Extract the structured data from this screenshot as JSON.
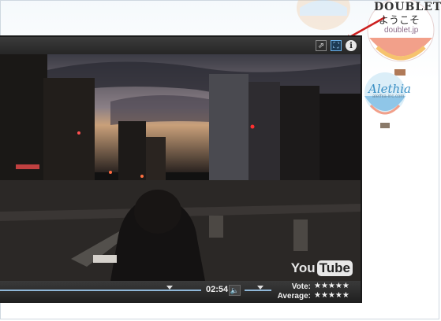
{
  "branding": {
    "doublet_name": "DOUBLET",
    "doublet_greeting": "ようこそ",
    "doublet_url": "doublet.jp",
    "alethia_name": "Alethia",
    "alethia_url": "alethia-inc.com"
  },
  "player": {
    "topbar": {
      "popout_icon": "popout-icon",
      "fullscreen_icon": "fullscreen-icon",
      "info_label": "i"
    },
    "video": {
      "logo_you": "You",
      "logo_tube": "Tube"
    },
    "controls": {
      "time": "02:54",
      "volume_icon": "speaker-icon",
      "vote_label": "Vote:",
      "average_label": "Average:",
      "vote_stars": "★★★★★",
      "average_stars": "★★★★★"
    }
  },
  "colors": {
    "arrow": "#cc1f1f",
    "progress": "#8fb7d8",
    "player_bg": "#2a2a2a"
  }
}
